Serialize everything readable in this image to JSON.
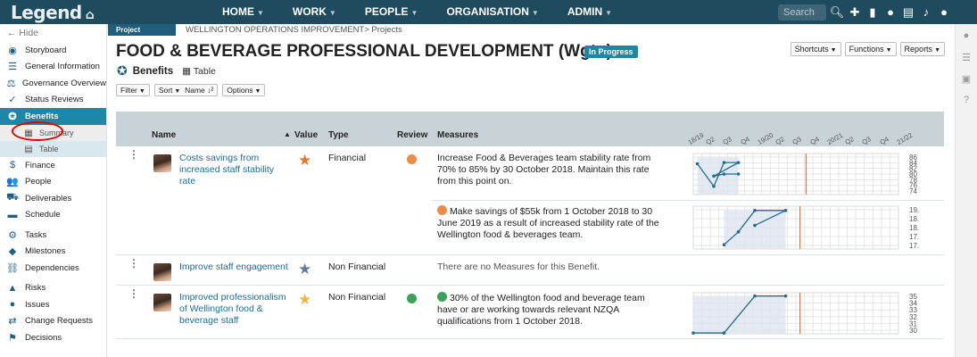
{
  "app": {
    "logo": "Legend",
    "home_icon": "home-icon"
  },
  "nav": {
    "items": [
      {
        "label": "HOME"
      },
      {
        "label": "WORK"
      },
      {
        "label": "PEOPLE"
      },
      {
        "label": "ORGANISATION"
      },
      {
        "label": "ADMIN"
      }
    ],
    "search_placeholder": "Search",
    "icons": [
      "search-icon",
      "plus-icon",
      "bookmark-icon",
      "chat-icon",
      "document-icon",
      "bell-icon",
      "user-icon"
    ]
  },
  "sidebar": {
    "hide_label": "Hide",
    "items": [
      {
        "label": "Storyboard",
        "icon": "storyboard-icon",
        "glyph": "◉"
      },
      {
        "label": "General Information",
        "icon": "info-icon",
        "glyph": "☰"
      },
      {
        "label": "Governance Overview",
        "icon": "governance-icon",
        "glyph": "⚖"
      },
      {
        "label": "Status Reviews",
        "icon": "status-icon",
        "glyph": "✓"
      },
      {
        "label": "Benefits",
        "icon": "benefits-icon",
        "glyph": "✪",
        "active": true
      },
      {
        "label": "Summary",
        "icon": "grid-icon",
        "glyph": "▦",
        "sub": true
      },
      {
        "label": "Table",
        "icon": "table-icon",
        "glyph": "▤",
        "sub": true,
        "selected": true
      },
      {
        "label": "Finance",
        "icon": "dollar-icon",
        "glyph": "$"
      },
      {
        "label": "People",
        "icon": "people-icon",
        "glyph": "👥"
      },
      {
        "label": "Deliverables",
        "icon": "truck-icon",
        "glyph": "⛟"
      },
      {
        "label": "Schedule",
        "icon": "schedule-icon",
        "glyph": "▬"
      },
      {
        "label": "Tasks",
        "icon": "tasks-icon",
        "glyph": "⚙",
        "gap": true
      },
      {
        "label": "Milestones",
        "icon": "milestone-icon",
        "glyph": "◆"
      },
      {
        "label": "Dependencies",
        "icon": "link-icon",
        "glyph": "⛓"
      },
      {
        "label": "Risks",
        "icon": "warning-icon",
        "glyph": "▲",
        "gap": true
      },
      {
        "label": "Issues",
        "icon": "issue-icon",
        "glyph": "●"
      },
      {
        "label": "Change Requests",
        "icon": "change-icon",
        "glyph": "⇄"
      },
      {
        "label": "Decisions",
        "icon": "decision-icon",
        "glyph": "⚑"
      }
    ]
  },
  "page": {
    "project_tab": "Project",
    "breadcrumb": "WELLINGTON OPERATIONS IMPROVEMENT> Projects",
    "title": "FOOD & BEVERAGE PROFESSIONAL DEVELOPMENT (Wgtn)",
    "status": "In Progress",
    "buttons": {
      "shortcuts": "Shortcuts",
      "functions": "Functions",
      "reports": "Reports"
    },
    "section": "Benefits",
    "view": "Table",
    "toolbar": {
      "filter": "Filter",
      "sort": "Sort",
      "name": "Name",
      "options": "Options"
    }
  },
  "table": {
    "headers": {
      "name": "Name",
      "value": "Value",
      "type": "Type",
      "review": "Review",
      "measures": "Measures"
    },
    "timeline_ticks": [
      "18/19",
      "Q2",
      "Q3",
      "Q4",
      "19/20",
      "Q2",
      "Q3",
      "Q4",
      "20/21",
      "Q2",
      "Q3",
      "Q4",
      "21/22"
    ],
    "rows": [
      {
        "name": "Costs savings from increased staff stability rate",
        "value_color": "#e8752a",
        "type": "Financial",
        "review_color": "#f08a45",
        "measures": [
          {
            "dot": "",
            "text": "Increase Food & Beverages team stability rate from 70% to 85% by 30 October 2018. Maintain this rate from this point on.",
            "y_ticks": [
              "86",
              "84",
              "82",
              "80",
              "78",
              "76",
              "74"
            ],
            "ylim": [
              73,
              87
            ]
          },
          {
            "dot": "#f08a45",
            "text": "Make savings of $55k from 1 October 2018 to 30 June 2019 as a result of increased stability rate of the Wellington food & beverages team.",
            "y_ticks": [
              "19.0",
              "18.5",
              "18.0",
              "17.5",
              "17.0"
            ],
            "ylim": [
              16.8,
              19.1
            ]
          }
        ]
      },
      {
        "name": "Improve staff engagement",
        "value_color": "#5f7e9c",
        "type": "Non Financial",
        "review_color": "",
        "measures": [
          {
            "dot": "",
            "text": "There are no Measures for this Benefit."
          }
        ]
      },
      {
        "name": "Improved professionalism of Wellington food & beverage staff",
        "value_color": "#f2b63c",
        "type": "Non Financial",
        "review_color": "#3aa35a",
        "measures": [
          {
            "dot": "#3aa35a",
            "text": "30% of the Wellington food and beverage team have or are working towards relevant NZQA qualifications from 1 October 2018.",
            "y_ticks": [
              "35",
              "34",
              "33",
              "32",
              "31",
              "30"
            ],
            "ylim": [
              30,
              35.5
            ]
          }
        ]
      }
    ]
  }
}
